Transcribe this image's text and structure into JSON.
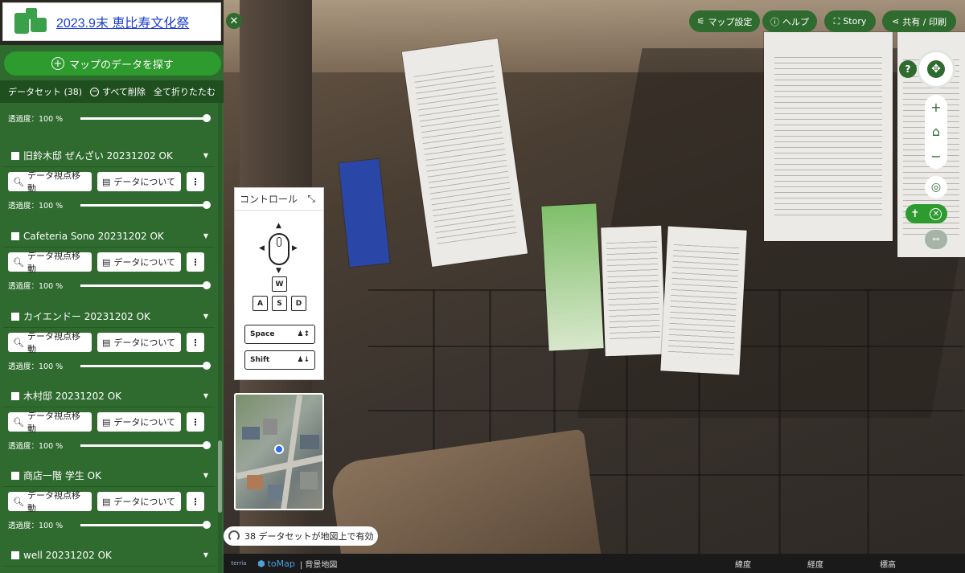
{
  "header": {
    "title": "2023.9末 恵比寿文化祭"
  },
  "sidebar": {
    "find_data_label": "マップのデータを探す",
    "dataset_count_label": "データセット (38)",
    "clear_all_label": "すべて削除",
    "collapse_all_label": "全て折りたたむ",
    "partial_top": {
      "opacity_label": "透過度：100 %",
      "opacity_value": 1.0
    },
    "datasets": [
      {
        "name": "旧鈴木邸 ぜんざい 20231202 OK",
        "move_label": "データ視点移動",
        "about_label": "データについて",
        "opacity_label": "透過度：100 %",
        "opacity_value": 1.0
      },
      {
        "name": "Cafeteria Sono 20231202 OK",
        "move_label": "データ視点移動",
        "about_label": "データについて",
        "opacity_label": "透過度：100 %",
        "opacity_value": 1.0
      },
      {
        "name": "カイエンドー 20231202 OK",
        "move_label": "データ視点移動",
        "about_label": "データについて",
        "opacity_label": "透過度：100 %",
        "opacity_value": 1.0
      },
      {
        "name": "木村邸 20231202 OK",
        "move_label": "データ視点移動",
        "about_label": "データについて",
        "opacity_label": "透過度：100 %",
        "opacity_value": 1.0
      },
      {
        "name": "商店一階 学生 OK",
        "move_label": "データ視点移動",
        "about_label": "データについて",
        "opacity_label": "透過度：100 %",
        "opacity_value": 1.0
      },
      {
        "name": "well 20231202 OK"
      }
    ]
  },
  "toolbar": {
    "map_settings_label": "マップ設定",
    "help_label": "ヘルプ",
    "story_label": "Story",
    "share_label": "共有 / 印刷"
  },
  "controls_panel": {
    "title": "コントロール",
    "keys": [
      "W",
      "A",
      "S",
      "D"
    ],
    "space_label": "Space",
    "shift_label": "Shift"
  },
  "status": {
    "datasets_active_label": "38 データセットが地図上で有効"
  },
  "bottom_bar": {
    "terria_label": "terria",
    "tomap_label": "toMap",
    "basemap_label": "| 背景地図",
    "lat_label": "緯度",
    "lon_label": "経度",
    "elev_label": "標高"
  },
  "colors": {
    "sidebar_green": "#2f6b2f",
    "accent_green": "#2e9b2e",
    "link_blue": "#1a3dd0"
  },
  "icons": [
    "plus-circle-icon",
    "minus-circle-icon",
    "search-icon",
    "comment-icon",
    "more-vert-icon",
    "chevron-down-icon",
    "close-icon",
    "sliders-icon",
    "help-circle-icon",
    "story-icon",
    "share-icon",
    "compass-icon",
    "zoom-in-icon",
    "home-icon",
    "zoom-out-icon",
    "locate-icon",
    "pedestrian-icon",
    "measure-icon",
    "collapse-icon",
    "mouse-icon",
    "signal-icon"
  ]
}
